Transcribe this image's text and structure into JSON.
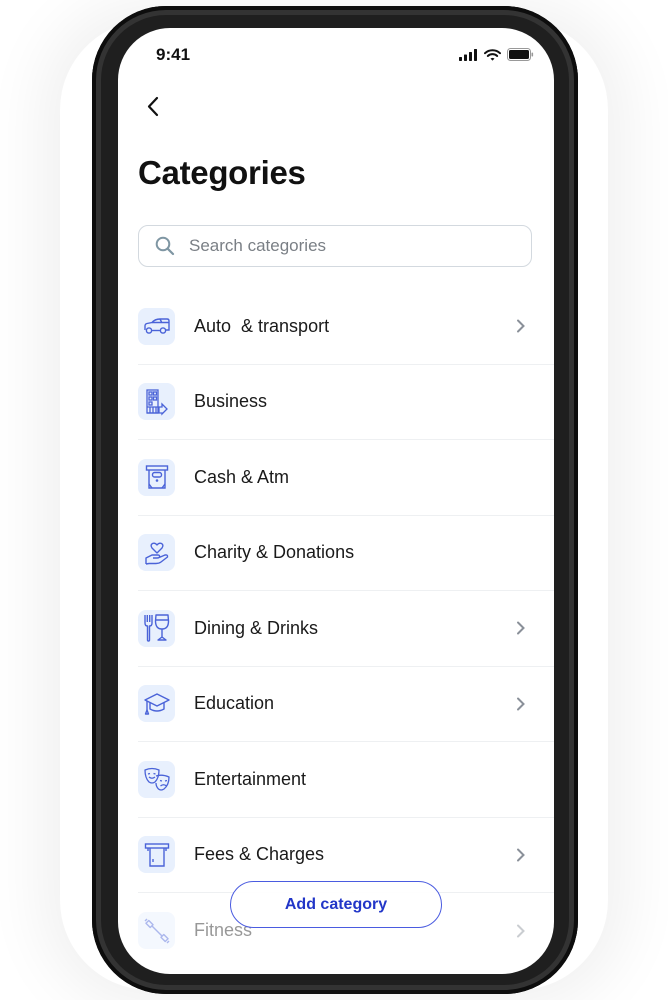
{
  "status_bar": {
    "time": "9:41"
  },
  "header": {
    "title": "Categories",
    "back_label": "Back"
  },
  "search": {
    "placeholder": "Search categories",
    "value": ""
  },
  "categories": [
    {
      "label": "Auto  & transport",
      "icon": "car-icon",
      "has_chevron": true
    },
    {
      "label": "Business",
      "icon": "building-icon",
      "has_chevron": false
    },
    {
      "label": "Cash & Atm",
      "icon": "atm-icon",
      "has_chevron": false
    },
    {
      "label": "Charity & Donations",
      "icon": "heart-hand-icon",
      "has_chevron": false
    },
    {
      "label": "Dining & Drinks",
      "icon": "fork-glass-icon",
      "has_chevron": true
    },
    {
      "label": "Education",
      "icon": "graduation-cap-icon",
      "has_chevron": true
    },
    {
      "label": "Entertainment",
      "icon": "theater-masks-icon",
      "has_chevron": false
    },
    {
      "label": "Fees & Charges",
      "icon": "card-slot-icon",
      "has_chevron": true
    },
    {
      "label": "Fitness",
      "icon": "dumbbell-icon",
      "has_chevron": true
    }
  ],
  "actions": {
    "add_category_label": "Add category"
  },
  "colors": {
    "accent": "#2236c8",
    "icon_stroke": "#4a63d8",
    "icon_bg": "#e8f0fd",
    "chevron": "#8a9099"
  }
}
